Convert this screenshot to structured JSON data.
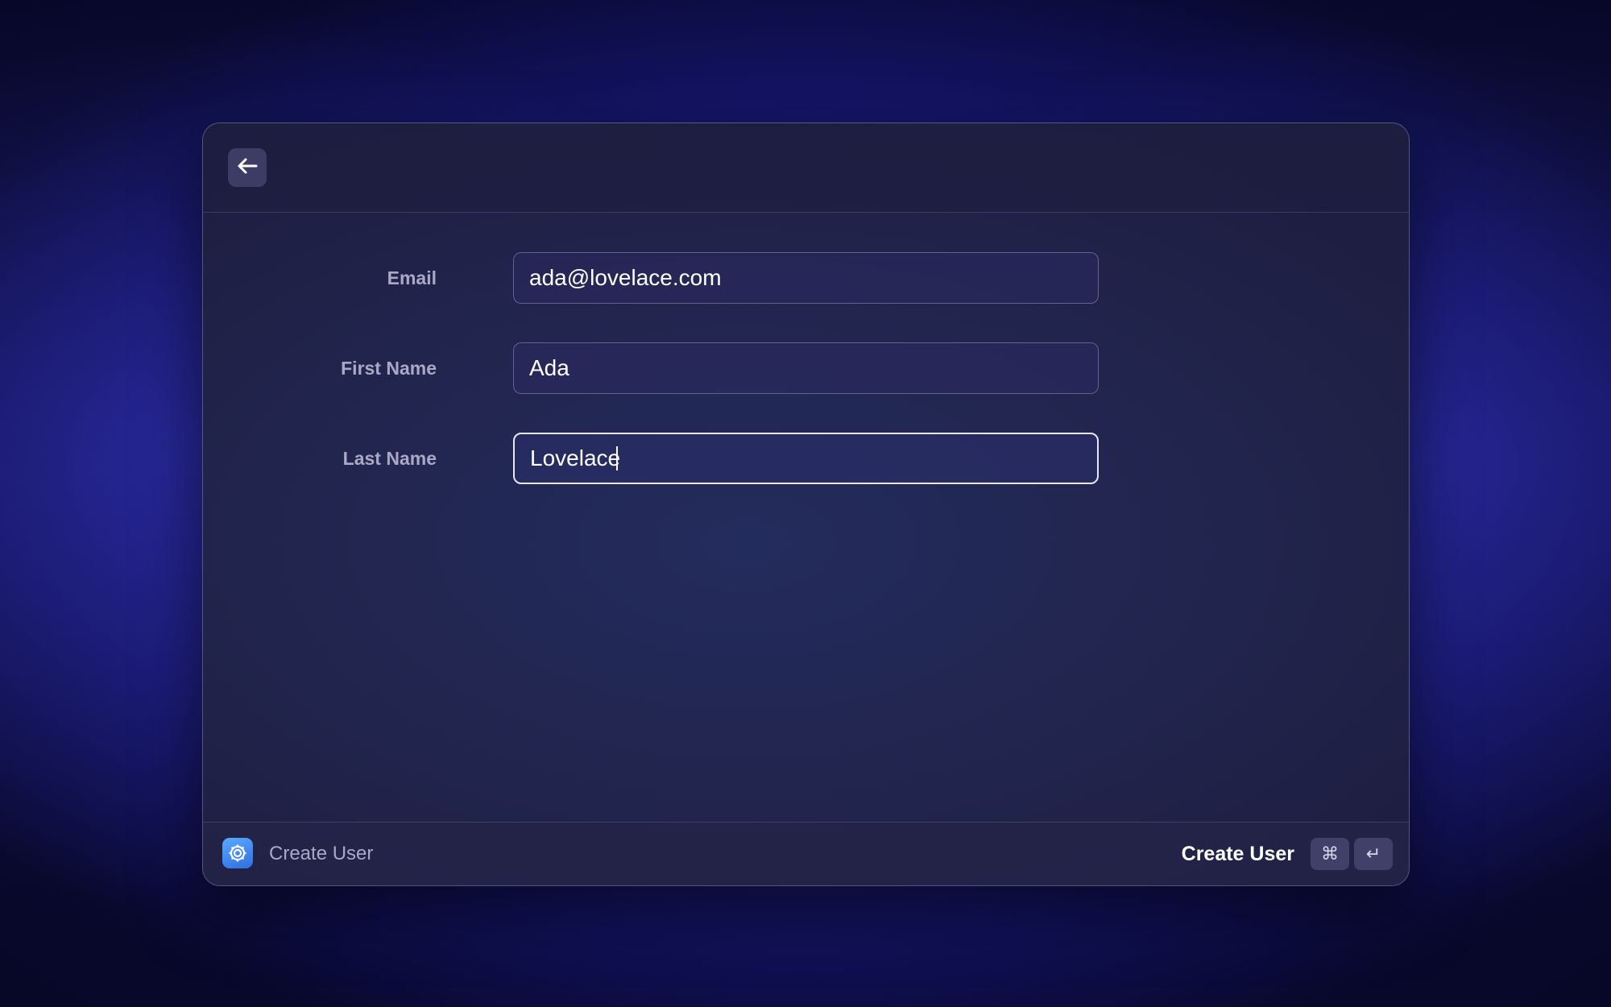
{
  "window": {
    "back_icon": "arrow-left-icon"
  },
  "form": {
    "fields": [
      {
        "label": "Email",
        "value": "ada@lovelace.com"
      },
      {
        "label": "First Name",
        "value": "Ada"
      },
      {
        "label": "Last Name",
        "value": "Lovelace",
        "focused": true
      }
    ]
  },
  "footer": {
    "app_icon": "gear-icon",
    "title": "Create User",
    "primary_action_label": "Create User",
    "shortcut_keys": [
      "⌘",
      "↵"
    ]
  },
  "colors": {
    "accent": "#3b82f6",
    "background": "#1f1f8c",
    "window": "#222650"
  }
}
